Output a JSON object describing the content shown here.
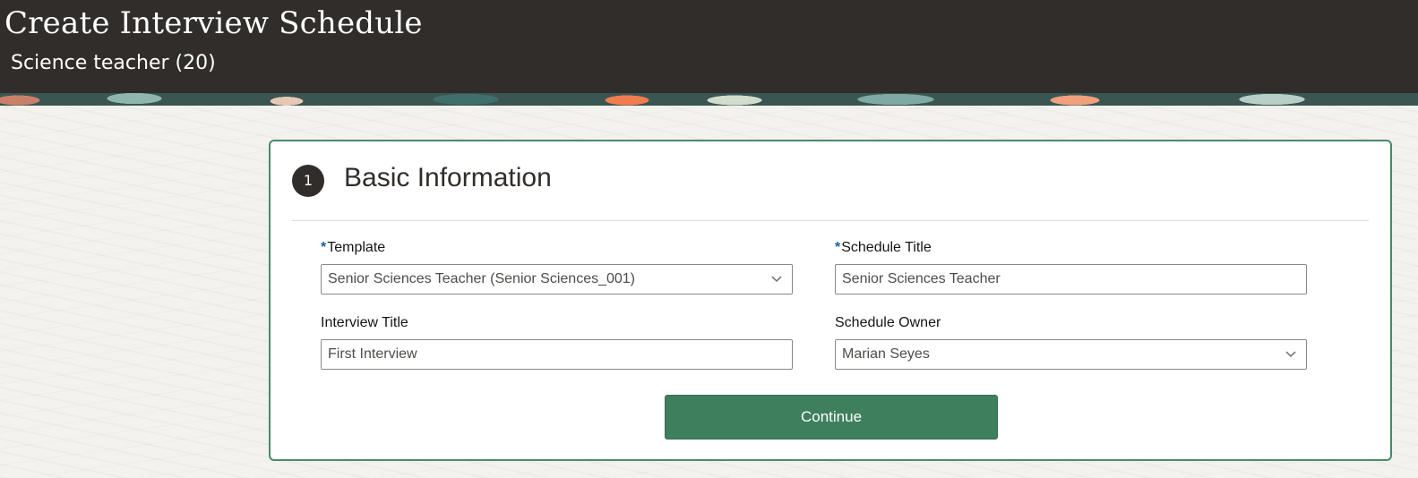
{
  "header": {
    "title": "Create Interview Schedule",
    "subtitle": "Science teacher (20)"
  },
  "step": {
    "number": "1",
    "title": "Basic Information"
  },
  "form": {
    "template": {
      "required_mark": "*",
      "label": "Template",
      "value": "Senior Sciences Teacher (Senior Sciences_001)"
    },
    "schedule_title": {
      "required_mark": "*",
      "label": "Schedule Title",
      "value": "Senior Sciences Teacher"
    },
    "interview_title": {
      "label": "Interview Title",
      "value": "First Interview"
    },
    "schedule_owner": {
      "label": "Schedule Owner",
      "value": "Marian Seyes"
    }
  },
  "actions": {
    "continue_label": "Continue"
  },
  "icons": {
    "dropdown": "chevron-down-icon"
  },
  "colors": {
    "header_bg": "#312d2a",
    "card_border": "#4a8a6a",
    "primary_button": "#3e7f5d",
    "required_mark": "#1660a8"
  }
}
